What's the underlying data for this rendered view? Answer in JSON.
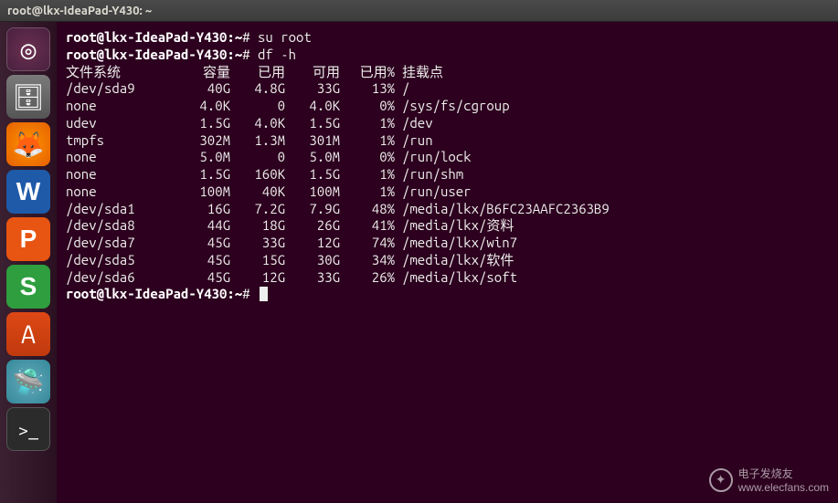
{
  "window": {
    "title": "root@lkx-IdeaPad-Y430: ~"
  },
  "launcher": {
    "items": [
      {
        "name": "dash-icon",
        "glyph": "◎"
      },
      {
        "name": "files-icon",
        "glyph": "🗄"
      },
      {
        "name": "firefox-icon",
        "glyph": "🦊"
      },
      {
        "name": "wps-writer-icon",
        "glyph": "W"
      },
      {
        "name": "wps-presentation-icon",
        "glyph": "P"
      },
      {
        "name": "wps-spreadsheet-icon",
        "glyph": "S"
      },
      {
        "name": "software-center-icon",
        "glyph": "A"
      },
      {
        "name": "devices-icon",
        "glyph": "🛸"
      },
      {
        "name": "terminal-icon",
        "glyph": ">_"
      }
    ]
  },
  "terminal": {
    "prompt_user_host": "root@lkx-IdeaPad-Y430",
    "prompt_path": "~",
    "prompt_suffix": "#",
    "lines": [
      {
        "cmd": "su root"
      },
      {
        "cmd": "df -h"
      }
    ],
    "df_header": {
      "filesystem": "文件系统",
      "size": "容量",
      "used": "已用",
      "avail": "可用",
      "use_pct": "已用%",
      "mounted": "挂载点"
    },
    "df_rows": [
      {
        "fs": "/dev/sda9",
        "size": "40G",
        "used": "4.8G",
        "avail": "33G",
        "pct": "13%",
        "mnt": "/"
      },
      {
        "fs": "none",
        "size": "4.0K",
        "used": "0",
        "avail": "4.0K",
        "pct": "0%",
        "mnt": "/sys/fs/cgroup"
      },
      {
        "fs": "udev",
        "size": "1.5G",
        "used": "4.0K",
        "avail": "1.5G",
        "pct": "1%",
        "mnt": "/dev"
      },
      {
        "fs": "tmpfs",
        "size": "302M",
        "used": "1.3M",
        "avail": "301M",
        "pct": "1%",
        "mnt": "/run"
      },
      {
        "fs": "none",
        "size": "5.0M",
        "used": "0",
        "avail": "5.0M",
        "pct": "0%",
        "mnt": "/run/lock"
      },
      {
        "fs": "none",
        "size": "1.5G",
        "used": "160K",
        "avail": "1.5G",
        "pct": "1%",
        "mnt": "/run/shm"
      },
      {
        "fs": "none",
        "size": "100M",
        "used": "40K",
        "avail": "100M",
        "pct": "1%",
        "mnt": "/run/user"
      },
      {
        "fs": "/dev/sda1",
        "size": "16G",
        "used": "7.2G",
        "avail": "7.9G",
        "pct": "48%",
        "mnt": "/media/lkx/B6FC23AAFC2363B9"
      },
      {
        "fs": "/dev/sda8",
        "size": "44G",
        "used": "18G",
        "avail": "26G",
        "pct": "41%",
        "mnt": "/media/lkx/资料"
      },
      {
        "fs": "/dev/sda7",
        "size": "45G",
        "used": "33G",
        "avail": "12G",
        "pct": "74%",
        "mnt": "/media/lkx/win7"
      },
      {
        "fs": "/dev/sda5",
        "size": "45G",
        "used": "15G",
        "avail": "30G",
        "pct": "34%",
        "mnt": "/media/lkx/软件"
      },
      {
        "fs": "/dev/sda6",
        "size": "45G",
        "used": "12G",
        "avail": "33G",
        "pct": "26%",
        "mnt": "/media/lkx/soft"
      }
    ]
  },
  "watermark": {
    "text": "电子发烧友",
    "url": "www.elecfans.com"
  }
}
